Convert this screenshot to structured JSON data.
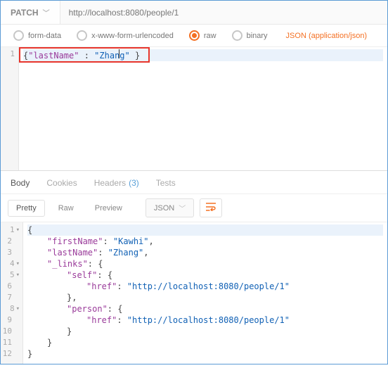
{
  "request": {
    "method": "PATCH",
    "url": "http://localhost:8080/people/1",
    "body_types": {
      "form_data": "form-data",
      "urlencoded": "x-www-form-urlencoded",
      "raw": "raw",
      "binary": "binary"
    },
    "selected_body_type": "raw",
    "content_type": "JSON (application/json)",
    "line_number": "1",
    "body_json": {
      "lastName": "Zhang"
    },
    "body_display": {
      "open": "{",
      "k1": "\"lastName\"",
      "sep": " : ",
      "v1_a": "\"Zhan",
      "v1_b": "g\"",
      "close": " }"
    }
  },
  "response": {
    "tabs": {
      "body": "Body",
      "cookies": "Cookies",
      "headers": "Headers",
      "headers_count": "(3)",
      "tests": "Tests"
    },
    "modes": {
      "pretty": "Pretty",
      "raw": "Raw",
      "preview": "Preview",
      "format": "JSON"
    },
    "json": {
      "firstName": "Kawhi",
      "lastName": "Zhang",
      "_links": {
        "self": {
          "href": "http://localhost:8080/people/1"
        },
        "person": {
          "href": "http://localhost:8080/people/1"
        }
      }
    },
    "lines": [
      "1",
      "2",
      "3",
      "4",
      "5",
      "6",
      "7",
      "8",
      "9",
      "10",
      "11",
      "12"
    ],
    "tokens": {
      "obr": "{",
      "cbr": "}",
      "k_first": "\"firstName\"",
      "k_last": "\"lastName\"",
      "k_links": "\"_links\"",
      "k_self": "\"self\"",
      "k_person": "\"person\"",
      "k_href": "\"href\"",
      "v_first": "\"Kawhi\"",
      "v_last": "\"Zhang\"",
      "v_href": "\"http://localhost:8080/people/1\"",
      "colon": ": ",
      "comma": ",",
      "cbr_comma": "},"
    }
  }
}
